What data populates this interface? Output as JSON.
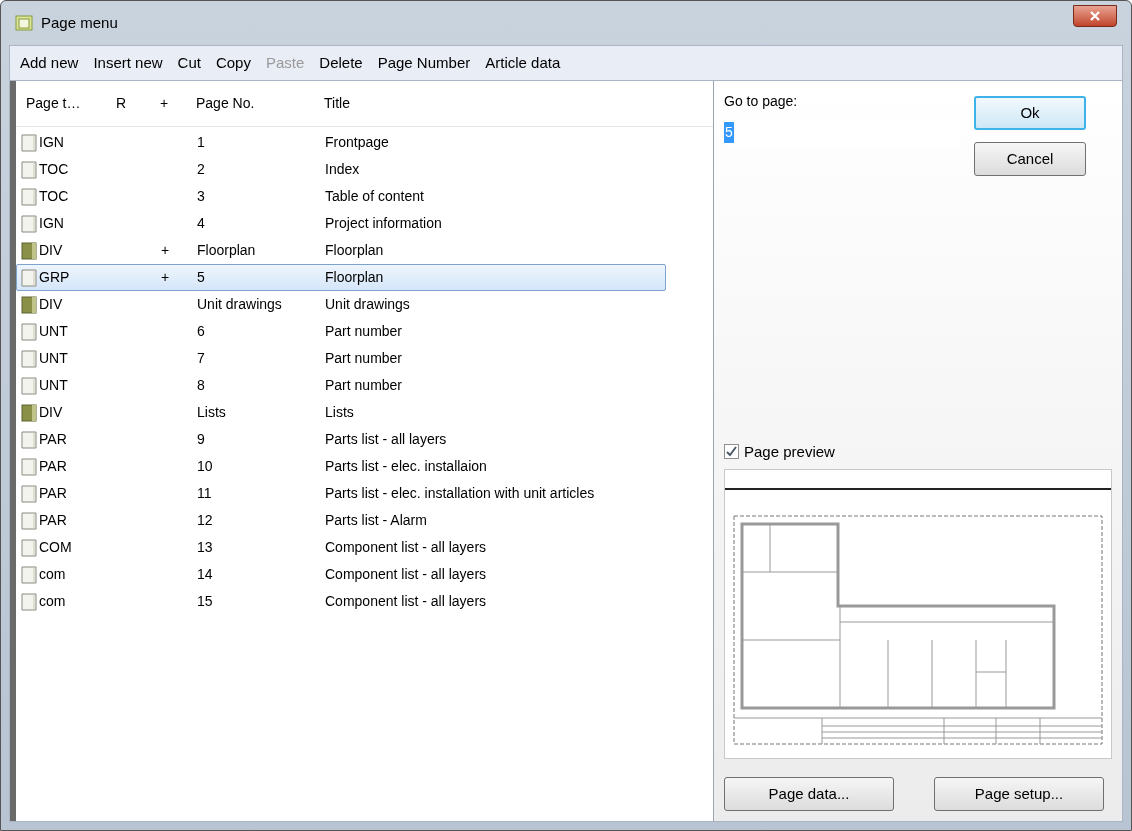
{
  "window": {
    "title": "Page menu"
  },
  "menu": [
    {
      "label": "Add new",
      "disabled": false
    },
    {
      "label": "Insert new",
      "disabled": false
    },
    {
      "label": "Cut",
      "disabled": false
    },
    {
      "label": "Copy",
      "disabled": false
    },
    {
      "label": "Paste",
      "disabled": true
    },
    {
      "label": "Delete",
      "disabled": false
    },
    {
      "label": "Page Number",
      "disabled": false
    },
    {
      "label": "Article data",
      "disabled": false
    }
  ],
  "table": {
    "columns": [
      "Page t…",
      "R",
      "+",
      "Page No.",
      "Title"
    ],
    "rows": [
      {
        "kind": "page",
        "type": "IGN",
        "plus": "",
        "page_no": "1",
        "title": "Frontpage",
        "selected": false
      },
      {
        "kind": "page",
        "type": "TOC",
        "plus": "",
        "page_no": "2",
        "title": "Index",
        "selected": false
      },
      {
        "kind": "page",
        "type": "TOC",
        "plus": "",
        "page_no": "3",
        "title": "Table of content",
        "selected": false
      },
      {
        "kind": "page",
        "type": "IGN",
        "plus": "",
        "page_no": "4",
        "title": "Project information",
        "selected": false
      },
      {
        "kind": "divider",
        "type": "DIV",
        "plus": "+",
        "page_no": "Floorplan",
        "title": "Floorplan",
        "selected": false
      },
      {
        "kind": "page",
        "type": "GRP",
        "plus": "+",
        "page_no": "5",
        "title": "Floorplan",
        "selected": true
      },
      {
        "kind": "divider",
        "type": "DIV",
        "plus": "",
        "page_no": "Unit drawings",
        "title": "Unit drawings",
        "selected": false
      },
      {
        "kind": "page",
        "type": "UNT",
        "plus": "",
        "page_no": "6",
        "title": "Part number",
        "selected": false
      },
      {
        "kind": "page",
        "type": "UNT",
        "plus": "",
        "page_no": "7",
        "title": "Part number",
        "selected": false
      },
      {
        "kind": "page",
        "type": "UNT",
        "plus": "",
        "page_no": "8",
        "title": "Part number",
        "selected": false
      },
      {
        "kind": "divider",
        "type": "DIV",
        "plus": "",
        "page_no": "Lists",
        "title": "Lists",
        "selected": false
      },
      {
        "kind": "page",
        "type": "PAR",
        "plus": "",
        "page_no": "9",
        "title": "Parts list - all layers",
        "selected": false
      },
      {
        "kind": "page",
        "type": "PAR",
        "plus": "",
        "page_no": "10",
        "title": "Parts list - elec. installaion",
        "selected": false
      },
      {
        "kind": "page",
        "type": "PAR",
        "plus": "",
        "page_no": "11",
        "title": "Parts list - elec. installation with unit articles",
        "selected": false
      },
      {
        "kind": "page",
        "type": "PAR",
        "plus": "",
        "page_no": "12",
        "title": "Parts list - Alarm",
        "selected": false
      },
      {
        "kind": "page",
        "type": "COM",
        "plus": "",
        "page_no": "13",
        "title": "Component list - all layers",
        "selected": false
      },
      {
        "kind": "page",
        "type": "com",
        "plus": "",
        "page_no": "14",
        "title": "Component list - all layers",
        "selected": false
      },
      {
        "kind": "page",
        "type": "com",
        "plus": "",
        "page_no": "15",
        "title": "Component list - all layers",
        "selected": false
      }
    ]
  },
  "goto": {
    "label": "Go to page:",
    "value": "5"
  },
  "buttons": {
    "ok": "Ok",
    "cancel": "Cancel",
    "page_data": "Page data...",
    "page_setup": "Page setup..."
  },
  "preview": {
    "label": "Page preview",
    "checked": true
  }
}
